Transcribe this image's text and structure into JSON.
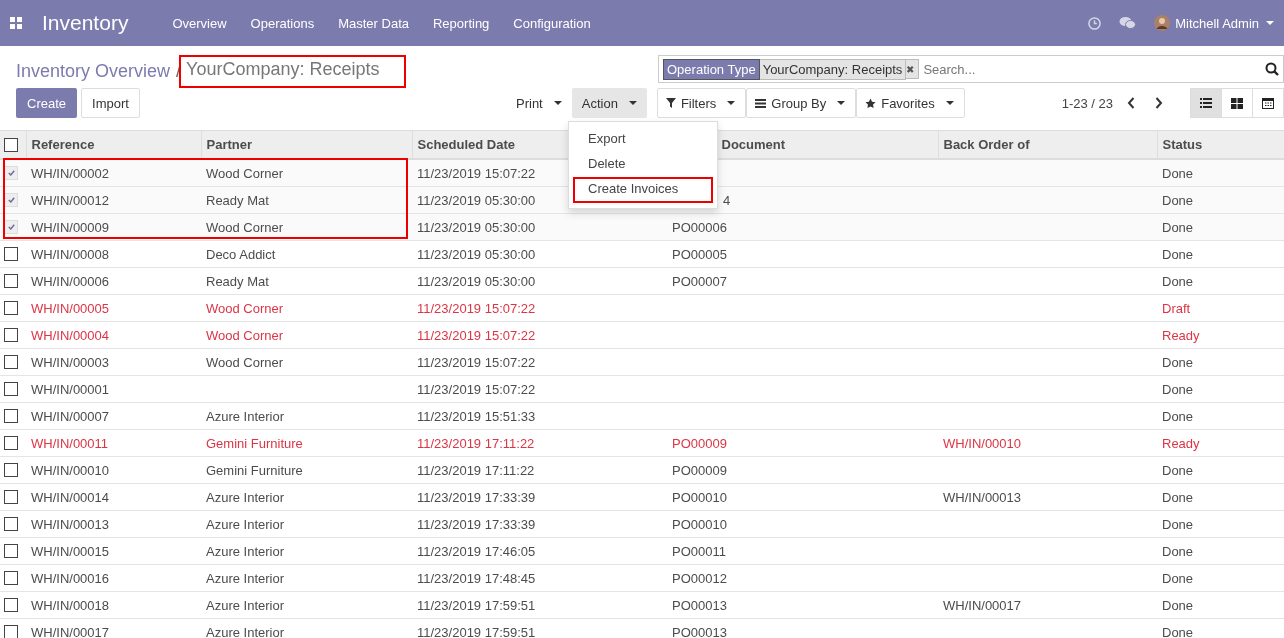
{
  "navbar": {
    "app": "Inventory",
    "menu": [
      "Overview",
      "Operations",
      "Master Data",
      "Reporting",
      "Configuration"
    ],
    "user": "Mitchell Admin"
  },
  "breadcrumb": {
    "parent": "Inventory Overview",
    "separator": "/",
    "current": "YourCompany: Receipts",
    "framed": true
  },
  "buttons": {
    "create": "Create",
    "import": "Import"
  },
  "actions": [
    {
      "label": "Print",
      "open": false
    },
    {
      "label": "Action",
      "open": true
    }
  ],
  "action_menu": [
    {
      "label": "Export",
      "framed": false
    },
    {
      "label": "Delete",
      "framed": false
    },
    {
      "label": "Create Invoices",
      "framed": true
    }
  ],
  "search": {
    "facet_label": "Operation Type",
    "facet_value": "YourCompany: Receipts",
    "remove": "✖",
    "placeholder": "Search..."
  },
  "filters": [
    "Filters",
    "Group By",
    "Favorites"
  ],
  "pager": "1-23 / 23",
  "views": [
    {
      "kind": "list",
      "selected": true
    },
    {
      "kind": "kanban",
      "selected": false
    },
    {
      "kind": "calendar",
      "selected": false
    }
  ],
  "table": {
    "all_selected": false,
    "columns": [
      "Reference",
      "Partner",
      "Scheduled Date",
      "Document",
      "Back Order of",
      "Status"
    ],
    "rows": [
      {
        "selected": true,
        "framed": true,
        "highlight": false,
        "cells": [
          "WH/IN/00002",
          "Wood Corner",
          "11/23/2019 15:07:22",
          "",
          "",
          "Done"
        ]
      },
      {
        "selected": true,
        "framed": true,
        "highlight": false,
        "cells": [
          "WH/IN/00012",
          "Ready Mat",
          "11/23/2019 05:30:00",
          "4",
          "",
          "Done"
        ]
      },
      {
        "selected": true,
        "framed": true,
        "highlight": false,
        "cells": [
          "WH/IN/00009",
          "Wood Corner",
          "11/23/2019 05:30:00",
          "PO00006",
          "",
          "Done"
        ]
      },
      {
        "selected": false,
        "framed": false,
        "highlight": false,
        "cells": [
          "WH/IN/00008",
          "Deco Addict",
          "11/23/2019 05:30:00",
          "PO00005",
          "",
          "Done"
        ]
      },
      {
        "selected": false,
        "framed": false,
        "highlight": false,
        "cells": [
          "WH/IN/00006",
          "Ready Mat",
          "11/23/2019 05:30:00",
          "PO00007",
          "",
          "Done"
        ]
      },
      {
        "selected": false,
        "framed": false,
        "highlight": true,
        "cells": [
          "WH/IN/00005",
          "Wood Corner",
          "11/23/2019 15:07:22",
          "",
          "",
          "Draft"
        ]
      },
      {
        "selected": false,
        "framed": false,
        "highlight": true,
        "cells": [
          "WH/IN/00004",
          "Wood Corner",
          "11/23/2019 15:07:22",
          "",
          "",
          "Ready"
        ]
      },
      {
        "selected": false,
        "framed": false,
        "highlight": false,
        "cells": [
          "WH/IN/00003",
          "Wood Corner",
          "11/23/2019 15:07:22",
          "",
          "",
          "Done"
        ]
      },
      {
        "selected": false,
        "framed": false,
        "highlight": false,
        "cells": [
          "WH/IN/00001",
          "",
          "11/23/2019 15:07:22",
          "",
          "",
          "Done"
        ]
      },
      {
        "selected": false,
        "framed": false,
        "highlight": false,
        "cells": [
          "WH/IN/00007",
          "Azure Interior",
          "11/23/2019 15:51:33",
          "",
          "",
          "Done"
        ]
      },
      {
        "selected": false,
        "framed": false,
        "highlight": true,
        "cells": [
          "WH/IN/00011",
          "Gemini Furniture",
          "11/23/2019 17:11:22",
          "PO00009",
          "WH/IN/00010",
          "Ready"
        ]
      },
      {
        "selected": false,
        "framed": false,
        "highlight": false,
        "cells": [
          "WH/IN/00010",
          "Gemini Furniture",
          "11/23/2019 17:11:22",
          "PO00009",
          "",
          "Done"
        ]
      },
      {
        "selected": false,
        "framed": false,
        "highlight": false,
        "cells": [
          "WH/IN/00014",
          "Azure Interior",
          "11/23/2019 17:33:39",
          "PO00010",
          "WH/IN/00013",
          "Done"
        ]
      },
      {
        "selected": false,
        "framed": false,
        "highlight": false,
        "cells": [
          "WH/IN/00013",
          "Azure Interior",
          "11/23/2019 17:33:39",
          "PO00010",
          "",
          "Done"
        ]
      },
      {
        "selected": false,
        "framed": false,
        "highlight": false,
        "cells": [
          "WH/IN/00015",
          "Azure Interior",
          "11/23/2019 17:46:05",
          "PO00011",
          "",
          "Done"
        ]
      },
      {
        "selected": false,
        "framed": false,
        "highlight": false,
        "cells": [
          "WH/IN/00016",
          "Azure Interior",
          "11/23/2019 17:48:45",
          "PO00012",
          "",
          "Done"
        ]
      },
      {
        "selected": false,
        "framed": false,
        "highlight": false,
        "cells": [
          "WH/IN/00018",
          "Azure Interior",
          "11/23/2019 17:59:51",
          "PO00013",
          "WH/IN/00017",
          "Done"
        ]
      },
      {
        "selected": false,
        "framed": false,
        "highlight": false,
        "cells": [
          "WH/IN/00017",
          "Azure Interior",
          "11/23/2019 17:59:51",
          "PO00013",
          "",
          "Done"
        ]
      }
    ]
  }
}
